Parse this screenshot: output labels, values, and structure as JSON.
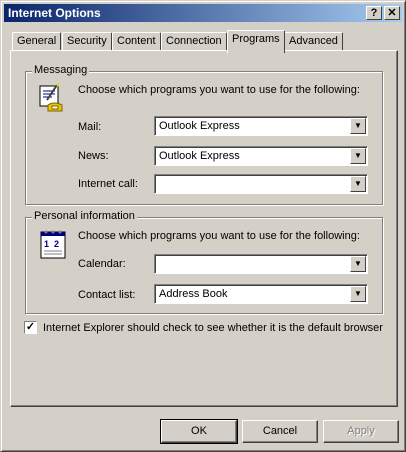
{
  "window": {
    "title": "Internet Options",
    "help_button": "?",
    "close_button": "✕"
  },
  "tabs": [
    {
      "label": "General"
    },
    {
      "label": "Security"
    },
    {
      "label": "Content"
    },
    {
      "label": "Connection"
    },
    {
      "label": "Programs"
    },
    {
      "label": "Advanced"
    }
  ],
  "active_tab": "Programs",
  "messaging": {
    "title": "Messaging",
    "description": "Choose which programs you want to use for the following:",
    "mail_label": "Mail:",
    "mail_value": "Outlook Express",
    "news_label": "News:",
    "news_value": "Outlook Express",
    "call_label": "Internet call:",
    "call_value": ""
  },
  "personal": {
    "title": "Personal information",
    "description": "Choose which programs you want to use for the following:",
    "calendar_label": "Calendar:",
    "calendar_value": "",
    "contacts_label": "Contact list:",
    "contacts_value": "Address Book"
  },
  "default_check": {
    "checked": true,
    "label": "Internet Explorer should check to see whether it is the default browser"
  },
  "buttons": {
    "ok": "OK",
    "cancel": "Cancel",
    "apply": "Apply"
  },
  "icons": {
    "messaging": "mail-pen-phone-icon",
    "personal": "calendar-icon"
  },
  "colors": {
    "title_start": "#0a246a",
    "title_end": "#a6caf0",
    "face": "#d4d0c8"
  }
}
